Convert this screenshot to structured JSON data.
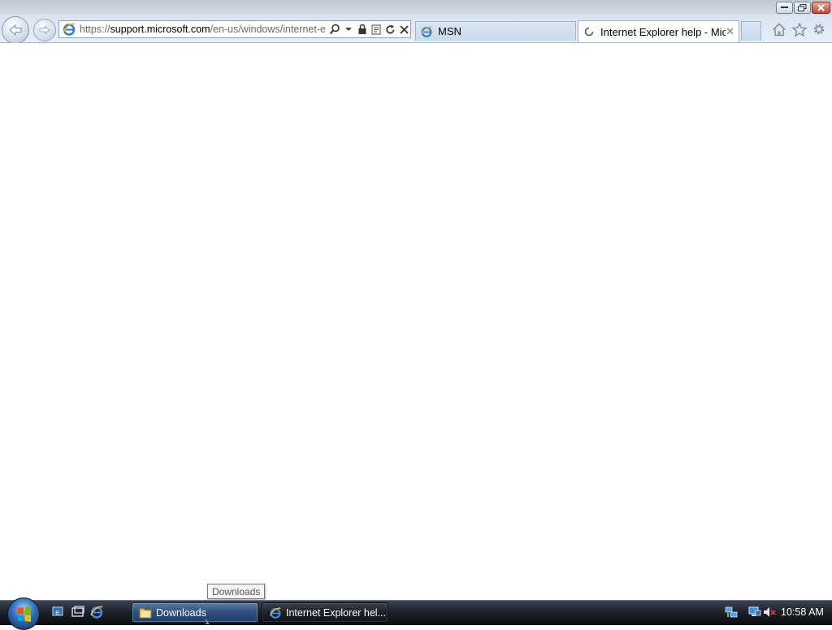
{
  "browser": {
    "address": {
      "scheme": "https://",
      "host": "support.microsoft.com",
      "path": "/en-us/windows/internet-e"
    },
    "tabs": [
      {
        "label": "MSN",
        "icon": "ie-icon",
        "active": false
      },
      {
        "label": "Internet Explorer help - Mic...",
        "icon": "loading-spinner-icon",
        "active": true
      }
    ],
    "tab_close": "✕"
  },
  "tooltip": {
    "text": "Downloads"
  },
  "taskbar": {
    "buttons": [
      {
        "label": "Downloads",
        "icon": "folder-icon",
        "active": true
      },
      {
        "label": "Internet Explorer hel...",
        "icon": "ie-icon",
        "active": false
      }
    ],
    "clock": "10:58 AM"
  },
  "colors": {
    "taskbar_bg": "#1c1f26",
    "toolbar_bg": "#dbe5f0",
    "page_bg": "#ffffff"
  }
}
